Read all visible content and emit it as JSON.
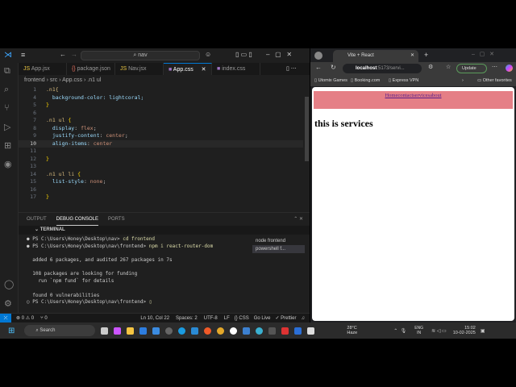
{
  "vscode": {
    "search": "nav",
    "tabs": [
      {
        "label": "App.jsx",
        "icon": "js"
      },
      {
        "label": "package.json",
        "icon": "json"
      },
      {
        "label": "Nav.jsx",
        "icon": "js"
      },
      {
        "label": "App.css",
        "icon": "css",
        "active": true
      },
      {
        "label": "index.css",
        "icon": "css"
      }
    ],
    "breadcrumb": [
      "frontend",
      "src",
      "App.css",
      ".n1 ul"
    ],
    "code": [
      {
        "n": "1",
        "t": [
          [
            ".n1{",
            "sel"
          ]
        ]
      },
      {
        "n": "4",
        "t": [
          [
            "  background-color: lightcoral;",
            "prop"
          ]
        ]
      },
      {
        "n": "5",
        "t": [
          [
            "}",
            "br"
          ]
        ]
      },
      {
        "n": "6",
        "t": []
      },
      {
        "n": "7",
        "t": [
          [
            ".n1 ul ",
            "sel"
          ],
          [
            "{",
            "br"
          ]
        ]
      },
      {
        "n": "8",
        "t": [
          [
            "  display",
            "prop"
          ],
          [
            ": ",
            ""
          ],
          [
            "flex",
            "val"
          ],
          [
            ";",
            ""
          ]
        ]
      },
      {
        "n": "9",
        "t": [
          [
            "  justify-content",
            "prop"
          ],
          [
            ": ",
            ""
          ],
          [
            "center",
            "val"
          ],
          [
            ";",
            ""
          ]
        ]
      },
      {
        "n": "10",
        "t": [
          [
            "  align-items",
            "prop"
          ],
          [
            ": ",
            ""
          ],
          [
            "center",
            "val"
          ]
        ],
        "current": true
      },
      {
        "n": "11",
        "t": []
      },
      {
        "n": "12",
        "t": [
          [
            "}",
            "br"
          ]
        ]
      },
      {
        "n": "13",
        "t": []
      },
      {
        "n": "14",
        "t": [
          [
            ".n1 ul li ",
            "sel"
          ],
          [
            "{",
            "br"
          ]
        ]
      },
      {
        "n": "15",
        "t": [
          [
            "  list-style",
            "prop"
          ],
          [
            ": ",
            ""
          ],
          [
            "none",
            "val"
          ],
          [
            ";",
            ""
          ]
        ]
      },
      {
        "n": "16",
        "t": []
      },
      {
        "n": "17",
        "t": [
          [
            "}",
            "br"
          ]
        ]
      }
    ],
    "panel_tabs": [
      "OUTPUT",
      "DEBUG CONSOLE",
      "PORTS"
    ],
    "terminal_header": "TERMINAL",
    "terminal": [
      {
        "p": "● PS C:\\Users\\Honey\\Desktop\\nav> ",
        "c": "cd frontend"
      },
      {
        "p": "● PS C:\\Users\\Honey\\Desktop\\nav\\frontend> ",
        "c": "npm i react-router-dom"
      },
      {
        "p": "",
        "c": ""
      },
      {
        "p": "  added 6 packages, and audited 267 packages in 7s",
        "c": ""
      },
      {
        "p": "",
        "c": ""
      },
      {
        "p": "  108 packages are looking for funding",
        "c": ""
      },
      {
        "p": "    run `npm fund` for details",
        "c": ""
      },
      {
        "p": "",
        "c": ""
      },
      {
        "p": "  found 0 vulnerabilities",
        "c": ""
      },
      {
        "p": "○ PS C:\\Users\\Honey\\Desktop\\nav\\frontend> ",
        "c": "▯"
      }
    ],
    "terminals": [
      "node frontend",
      "powershell f..."
    ],
    "status": {
      "errors": "⊗ 0 ⚠ 0",
      "ports": "⑂ 0",
      "pos": "Ln 10, Col 22",
      "spaces": "Spaces: 2",
      "enc": "UTF-8",
      "eol": "LF",
      "lang": "{} CSS",
      "golive": "Go Live",
      "prettier": "✓ Prettier"
    }
  },
  "browser": {
    "tab_title": "Vite + React",
    "url_host": "localhost",
    "url_rest": ":5173/servi...",
    "update": "Update",
    "bookmarks": [
      "Utomix Games",
      "Booking.com",
      "Express VPN"
    ],
    "other_favorites": "Other favorites",
    "nav_links": "Homecontactservicesabout",
    "heading": "this is services"
  },
  "taskbar": {
    "search": "Search",
    "weather_temp": "28°C",
    "weather_desc": "Haze",
    "lang": "ENG",
    "region": "IN",
    "time": "15:02",
    "date": "10-02-2025"
  }
}
